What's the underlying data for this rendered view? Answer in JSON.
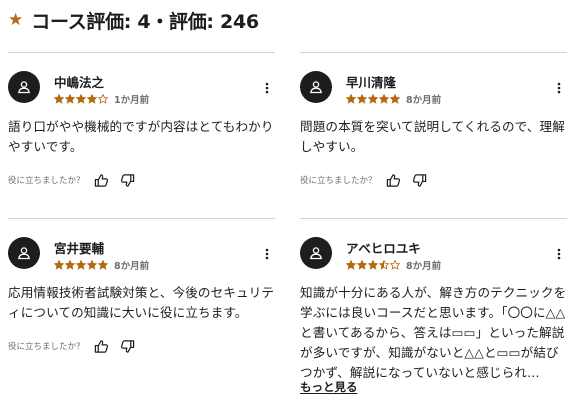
{
  "header": {
    "title": "コース評価: 4・評価: 246",
    "icon": "star-icon",
    "accent_color": "#b4690e"
  },
  "common": {
    "helpful_question": "役に立ちましたか？",
    "show_more": "もっと見る"
  },
  "reviews": [
    {
      "name": "中嶋法之",
      "rating": 4,
      "time": "1か月前",
      "text": "語り口がやや機械的ですが内容はとてもわかりやすいです。"
    },
    {
      "name": "早川清隆",
      "rating": 5,
      "time": "8か月前",
      "text": "問題の本質を突いて説明してくれるので、理解しやすい。"
    },
    {
      "name": "宮井要輔",
      "rating": 5,
      "time": "8か月前",
      "text": "応用情報技術者試験対策と、今後のセキュリティについての知識に大いに役に立ちます。"
    },
    {
      "name": "アベヒロユキ",
      "rating": 3.5,
      "time": "8か月前",
      "text": "知識が十分にある人が、解き方のテクニックを学ぶには良いコースだと思います。「〇〇に△△と書いてあるから、答えは▭▭」といった解説が多いですが、知識がないと△△と▭▭が結びつかず、解説になっていないと感じられ…"
    }
  ]
}
